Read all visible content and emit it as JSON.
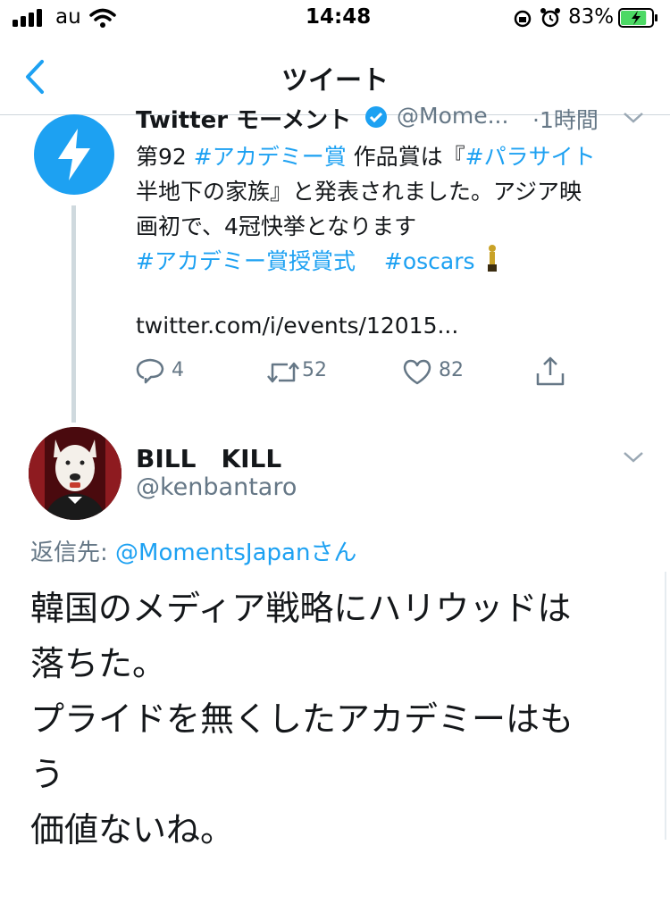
{
  "status_bar": {
    "carrier": "au",
    "time": "14:48",
    "battery_percent": "83%",
    "battery_level": 0.83
  },
  "nav": {
    "back_icon": "chevron-left-icon",
    "title": "ツイート"
  },
  "parent_tweet": {
    "author_name": "Twitter モーメント",
    "handle": "@Mome...",
    "time": "·1時間",
    "line1": {
      "a": "第92 ",
      "b": "#アカデミー賞",
      "c": " 作品賞は『",
      "d": "#パラサイト"
    },
    "line2": "半地下の家族』と発表されました。アジア映",
    "line3": "画初で、4冠快挙となります",
    "line4": {
      "a": "#アカデミー賞授賞式",
      "b": "#oscars"
    },
    "link": "twitter.com/i/events/12015...",
    "replies": "4",
    "retweets": "52",
    "likes": "82"
  },
  "reply_tweet": {
    "author_name": "BILL　KILL",
    "handle": "@kenbantaro",
    "replying_to_label": "返信先: ",
    "replying_to_user": "@MomentsJapanさん",
    "lines": [
      "韓国のメディア戦略にハリウッドは",
      "落ちた。",
      "プライドを無くしたアカデミーはも",
      "う",
      "価値ないね。"
    ]
  },
  "colors": {
    "accent": "#1da1f2",
    "text": "#14171a",
    "secondary": "#657786",
    "battery": "#4cd964"
  }
}
